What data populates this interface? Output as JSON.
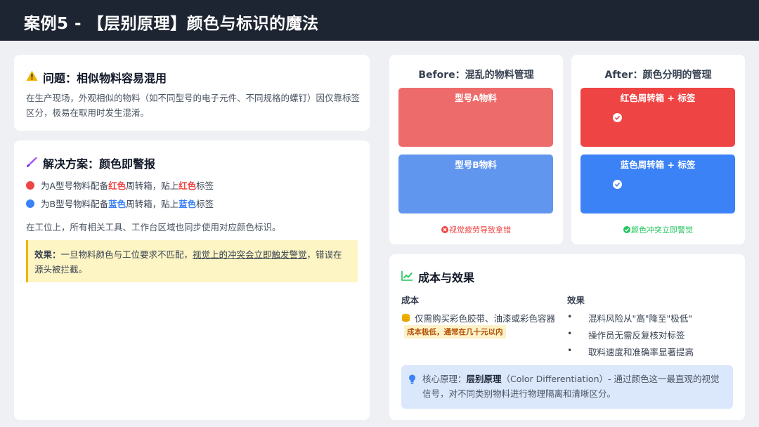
{
  "header": {
    "title": "案例5 - 【层别原理】颜色与标识的魔法"
  },
  "problem": {
    "title": "问题：相似物料容易混用",
    "desc": "在生产现场，外观相似的物料（如不同型号的电子元件、不同规格的螺钉）因仅靠标签区分，极易在取用时发生混淆。"
  },
  "solution": {
    "title": "解决方案：颜色即警报",
    "item_a": {
      "pre": "为A型号物料配备",
      "color1": "红色",
      "mid": "周转箱，贴上",
      "color2": "红色",
      "post": "标签"
    },
    "item_b": {
      "pre": "为B型号物料配备",
      "color1": "蓝色",
      "mid": "周转箱，贴上",
      "color2": "蓝色",
      "post": "标签"
    },
    "sync_text": "在工位上，所有相关工具、工作台区域也同步使用对应颜色标识。",
    "effect": {
      "label": "效果：",
      "pre": "一旦物料颜色与工位要求不匹配，",
      "underlined": "视觉上的冲突会立即触发警觉",
      "post": "，错误在源头被拦截。"
    }
  },
  "before": {
    "title": "Before：混乱的物料管理",
    "bin_a": "型号A物料",
    "bin_b": "型号B物料",
    "footer": "视觉疲劳导致拿错"
  },
  "after": {
    "title": "After：颜色分明的管理",
    "bin_a": "红色周转箱 + 标签",
    "bin_b": "蓝色周转箱 + 标签",
    "footer": "颜色冲突立即警觉"
  },
  "cost": {
    "title": "成本与效果",
    "cost_heading": "成本",
    "effect_heading": "效果",
    "cost_line": "仅需购买彩色胶带、油漆或彩色容器",
    "cost_note": "成本极低，通常在几十元以内",
    "effects": [
      "混料风险从\"高\"降至\"极低\"",
      "操作员无需反复核对标签",
      "取料速度和准确率显著提高"
    ],
    "principle": {
      "pre": "核心原理：",
      "bold": "层别原理",
      "post": "（Color Differentiation）- 通过颜色这一最直观的视觉信号，对不同类别物料进行物理隔离和清晰区分。"
    }
  },
  "colors": {
    "red": "#ef4444",
    "blue": "#3b82f6",
    "before_red": "#ee6b6b",
    "before_blue": "#6196ee",
    "accent_yellow": "#f0b400",
    "green": "#22c55e"
  },
  "icons": {
    "problem": "warning-icon",
    "solution": "brush-icon",
    "cost": "trend-chart-icon",
    "cost_line": "coins-icon",
    "principle": "lightbulb-icon",
    "before_footer": "error-circle-icon",
    "after_footer": "check-circle-icon"
  }
}
